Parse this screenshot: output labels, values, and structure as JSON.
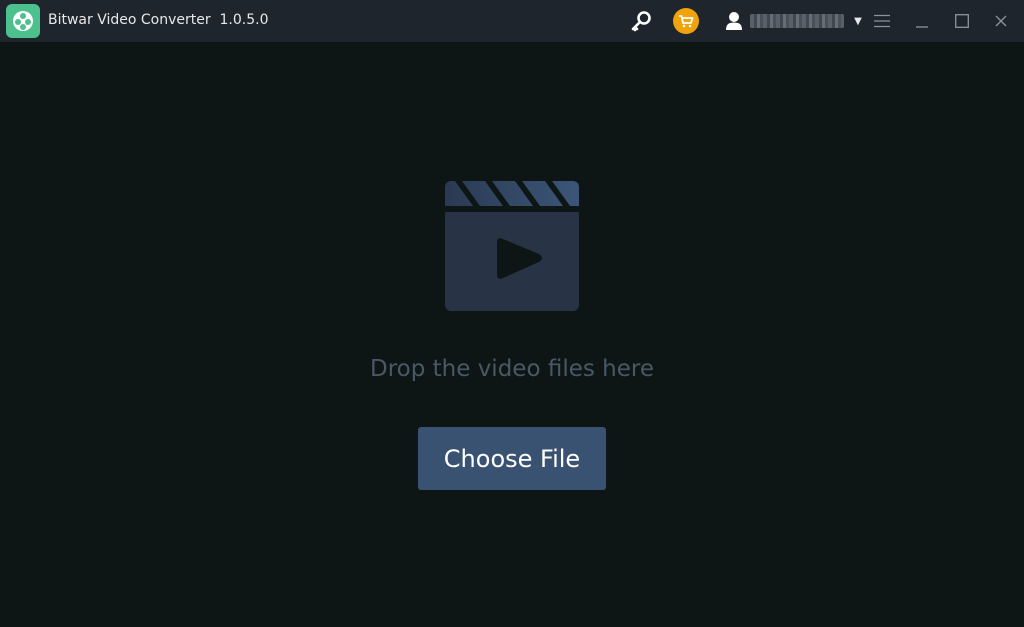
{
  "window": {
    "title": "Bitwar Video Converter  1.0.5.0"
  },
  "header": {
    "icons": {
      "key": "key-icon",
      "cart": "cart-icon",
      "user": "user-icon",
      "caret": "caret-down-icon",
      "menu": "hamburger-menu-icon",
      "minimize": "minimize-icon",
      "maximize": "maximize-icon",
      "close": "close-icon"
    },
    "caret_glyph": "▼",
    "close_glyph": "✕",
    "colors": {
      "cart_badge": "#f0a30a",
      "logo": "#4cc18d"
    }
  },
  "main": {
    "drop_text": "Drop the video files here",
    "choose_button_label": "Choose File",
    "colors": {
      "button": "#3a5272",
      "clapper": "#283446"
    }
  }
}
